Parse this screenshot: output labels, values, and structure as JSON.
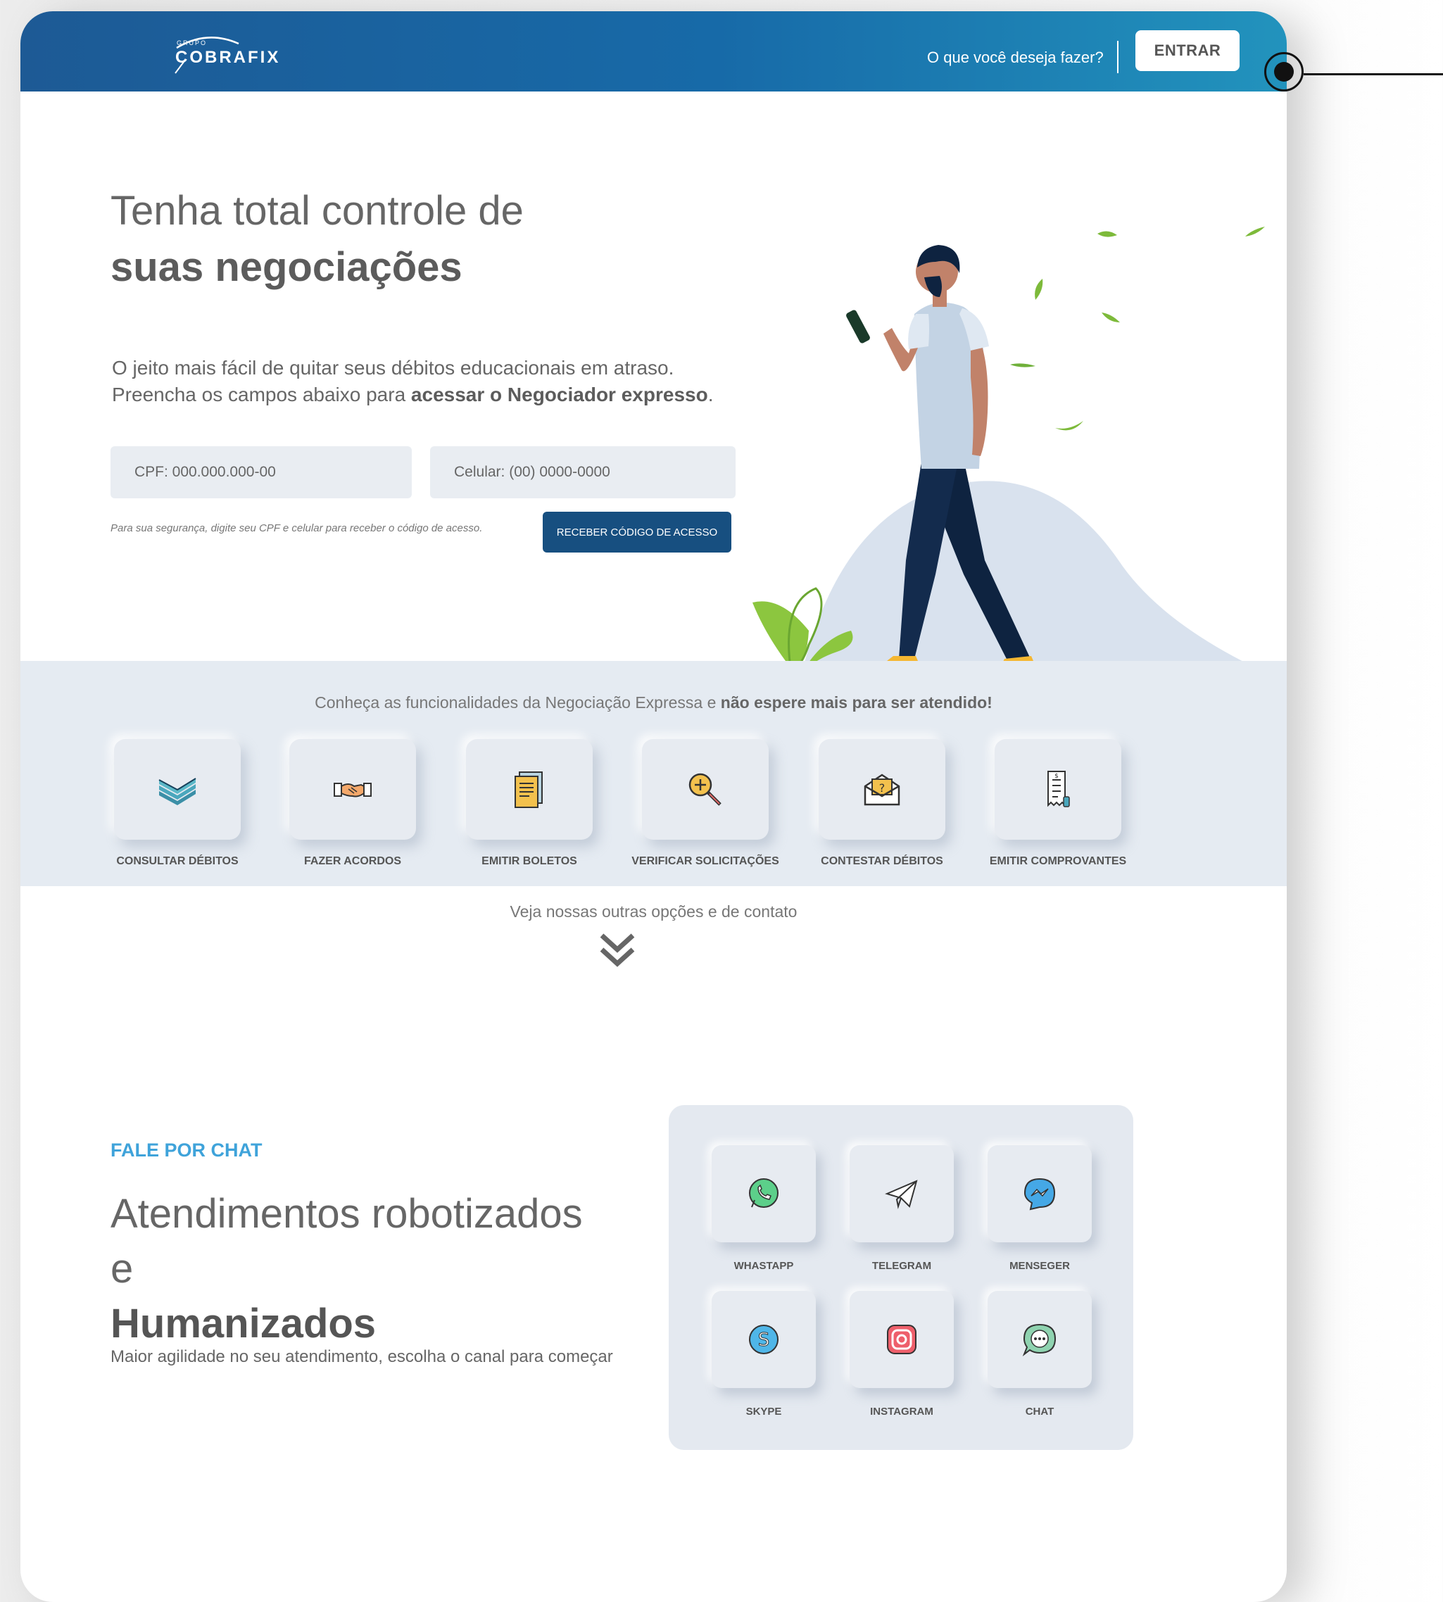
{
  "header": {
    "brand_small": "GRUPO",
    "brand": "COBRAFIX",
    "question": "O que você deseja fazer?",
    "login_label": "ENTRAR"
  },
  "hero": {
    "title_line1": "Tenha total controle de",
    "title_line2": "suas negociações",
    "text_line1": "O jeito mais fácil de quitar seus débitos educacionais em atraso.",
    "text_line2_prefix": "Preencha os campos abaixo para ",
    "text_line2_bold": "acessar o Negociador expresso",
    "text_line2_suffix": ".",
    "cpf_placeholder": "CPF: 000.000.000-00",
    "phone_placeholder": "Celular: (00) 0000-0000",
    "helper": "Para sua segurança, digite seu CPF e celular para receber o código de acesso.",
    "submit_label": "RECEBER CÓDIGO DE ACESSO"
  },
  "features": {
    "intro_prefix": "Conheça as funcionalidades da Negociação Expressa e ",
    "intro_bold": "não espere mais para ser atendido!",
    "items": [
      {
        "label": "CONSULTAR DÉBITOS",
        "icon": "money-stack-icon"
      },
      {
        "label": "FAZER ACORDOS",
        "icon": "handshake-icon"
      },
      {
        "label": "EMITIR BOLETOS",
        "icon": "document-icon"
      },
      {
        "label": "VERIFICAR SOLICITAÇÕES",
        "icon": "magnifier-icon"
      },
      {
        "label": "CONTESTAR DÉBITOS",
        "icon": "envelope-question-icon"
      },
      {
        "label": "EMITIR COMPROVANTES",
        "icon": "receipt-icon"
      }
    ]
  },
  "more": {
    "label": "Veja nossas outras opções e de contato"
  },
  "chat": {
    "kicker": "FALE POR CHAT",
    "title_line1": "Atendimentos robotizados",
    "title_line2_prefix": "e ",
    "title_line2_bold": "Humanizados",
    "subtitle": "Maior agilidade no seu atendimento, escolha o canal para começar",
    "channels": [
      {
        "label": "WHASTAPP",
        "icon": "whatsapp-icon"
      },
      {
        "label": "TELEGRAM",
        "icon": "telegram-icon"
      },
      {
        "label": "MENSEGER",
        "icon": "messenger-icon"
      },
      {
        "label": "SKYPE",
        "icon": "skype-icon"
      },
      {
        "label": "INSTAGRAM",
        "icon": "instagram-icon"
      },
      {
        "label": "CHAT",
        "icon": "chat-icon"
      }
    ]
  },
  "colors": {
    "header_start": "#1d5a95",
    "header_end": "#2293bd",
    "primary_button": "#174f80",
    "accent": "#3fa3da",
    "band": "#e5ebf2"
  }
}
